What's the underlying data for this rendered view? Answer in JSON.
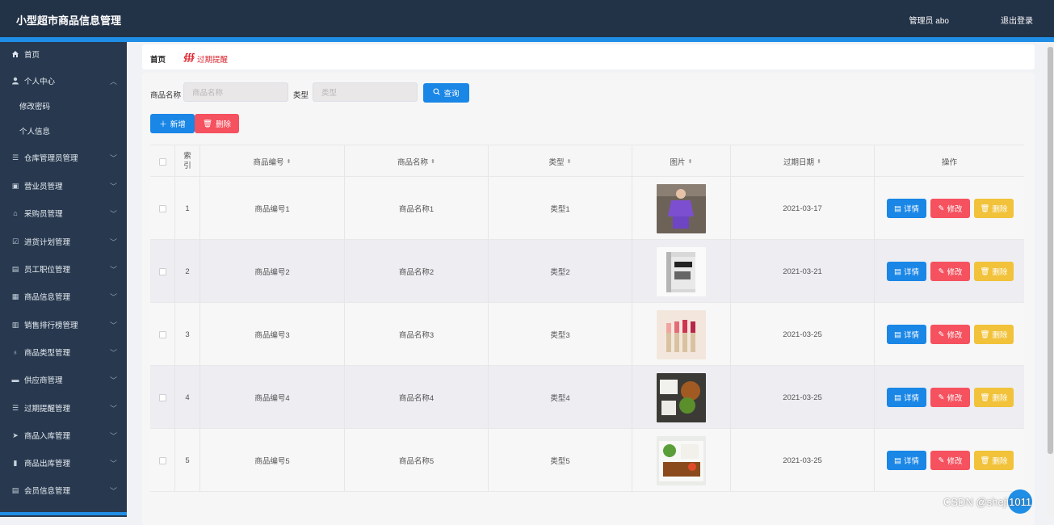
{
  "header": {
    "title": "小型超市商品信息管理",
    "user": "管理员 abo",
    "logout": "退出登录"
  },
  "sidebar": {
    "items": [
      {
        "label": "首页",
        "icon": "home-icon"
      },
      {
        "label": "个人中心",
        "icon": "user-icon",
        "expanded": true,
        "children": [
          {
            "label": "修改密码"
          },
          {
            "label": "个人信息"
          }
        ]
      },
      {
        "label": "仓库管理员管理",
        "icon": "list-icon"
      },
      {
        "label": "营业员管理",
        "icon": "briefcase-icon"
      },
      {
        "label": "采购员管理",
        "icon": "tag-icon"
      },
      {
        "label": "进货计划管理",
        "icon": "check-square-icon"
      },
      {
        "label": "员工职位管理",
        "icon": "printer-icon"
      },
      {
        "label": "商品信息管理",
        "icon": "box-icon"
      },
      {
        "label": "销售排行榜管理",
        "icon": "clipboard-icon"
      },
      {
        "label": "商品类型管理",
        "icon": "mic-icon"
      },
      {
        "label": "供应商管理",
        "icon": "ticket-icon"
      },
      {
        "label": "过期提醒管理",
        "icon": "list-icon"
      },
      {
        "label": "商品入库管理",
        "icon": "send-icon"
      },
      {
        "label": "商品出库管理",
        "icon": "bars-icon"
      },
      {
        "label": "会员信息管理",
        "icon": "doc-icon"
      }
    ]
  },
  "breadcrumb": {
    "home": "首页",
    "current": "过期提醒"
  },
  "search": {
    "name_label": "商品名称",
    "name_placeholder": "商品名称",
    "type_label": "类型",
    "type_placeholder": "类型",
    "query_button": "查询"
  },
  "actions": {
    "add": "新增",
    "delete": "删除"
  },
  "table": {
    "headers": [
      "索引",
      "商品编号",
      "商品名称",
      "类型",
      "图片",
      "过期日期",
      "操作"
    ],
    "rows": [
      {
        "index": "1",
        "code": "商品编号1",
        "name": "商品名称1",
        "type": "类型1",
        "date": "2021-03-17",
        "image": "purple-outfit"
      },
      {
        "index": "2",
        "code": "商品编号2",
        "name": "商品名称2",
        "type": "类型2",
        "date": "2021-03-21",
        "image": "book"
      },
      {
        "index": "3",
        "code": "商品编号3",
        "name": "商品名称3",
        "type": "类型3",
        "date": "2021-03-25",
        "image": "lipsticks"
      },
      {
        "index": "4",
        "code": "商品编号4",
        "name": "商品名称4",
        "type": "类型4",
        "date": "2021-03-25",
        "image": "food-box"
      },
      {
        "index": "5",
        "code": "商品编号5",
        "name": "商品名称5",
        "type": "类型5",
        "date": "2021-03-25",
        "image": "bento"
      }
    ],
    "row_buttons": {
      "detail": "详情",
      "edit": "修改",
      "delete": "删除"
    }
  },
  "watermark": "CSDN @shejì1011",
  "colors": {
    "header": "#223247",
    "sidebar": "#28394f",
    "accent": "#1a86e6",
    "danger": "#f5515f",
    "warning": "#f1c23a"
  }
}
